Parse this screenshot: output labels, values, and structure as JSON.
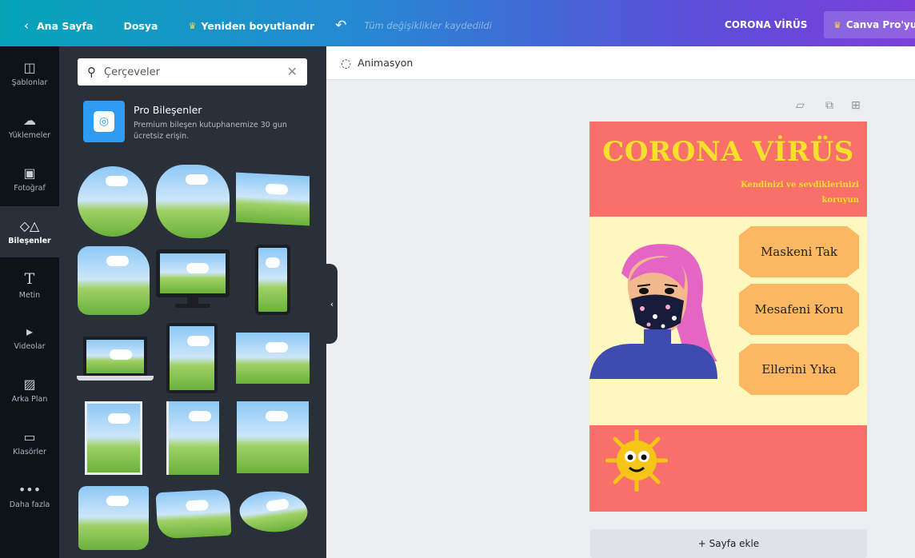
{
  "topbar": {
    "home": "Ana Sayfa",
    "file": "Dosya",
    "resize": "Yeniden boyutlandır",
    "saved_status": "Tüm değişiklikler kaydedildi",
    "doc_title": "CORONA VİRÜS",
    "pro": "Canva Pro'yu"
  },
  "rail": {
    "items": [
      {
        "label": "Şablonlar",
        "icon": "template-icon"
      },
      {
        "label": "Yüklemeler",
        "icon": "cloud-upload-icon"
      },
      {
        "label": "Fotoğraf",
        "icon": "photo-icon"
      },
      {
        "label": "Bileşenler",
        "icon": "elements-icon"
      },
      {
        "label": "Metin",
        "icon": "text-icon"
      },
      {
        "label": "Videolar",
        "icon": "video-icon"
      },
      {
        "label": "Arka Plan",
        "icon": "background-icon"
      },
      {
        "label": "Klasörler",
        "icon": "folder-icon"
      },
      {
        "label": "Daha fazla",
        "icon": "more-icon"
      }
    ],
    "active_index": 3
  },
  "panel": {
    "search_value": "Çerçeveler",
    "pro_title": "Pro Bileşenler",
    "pro_desc": "Premium bileşen kutuphanemize 30 gun ücretsiz erişin."
  },
  "toolbar": {
    "animation": "Animasyon"
  },
  "design": {
    "title": "CORONA VİRÜS",
    "subtitle": "Kendinizi ve sevdiklerinizi koruyun",
    "tips": [
      "Maskeni Tak",
      "Mesafeni Koru",
      "Ellerini Yıka"
    ],
    "colors": {
      "coral": "#f96f6a",
      "yellow": "#f5e02c",
      "cream": "#fdf8c0",
      "orange": "#fbb761"
    }
  },
  "add_page": "+ Sayfa ekle"
}
